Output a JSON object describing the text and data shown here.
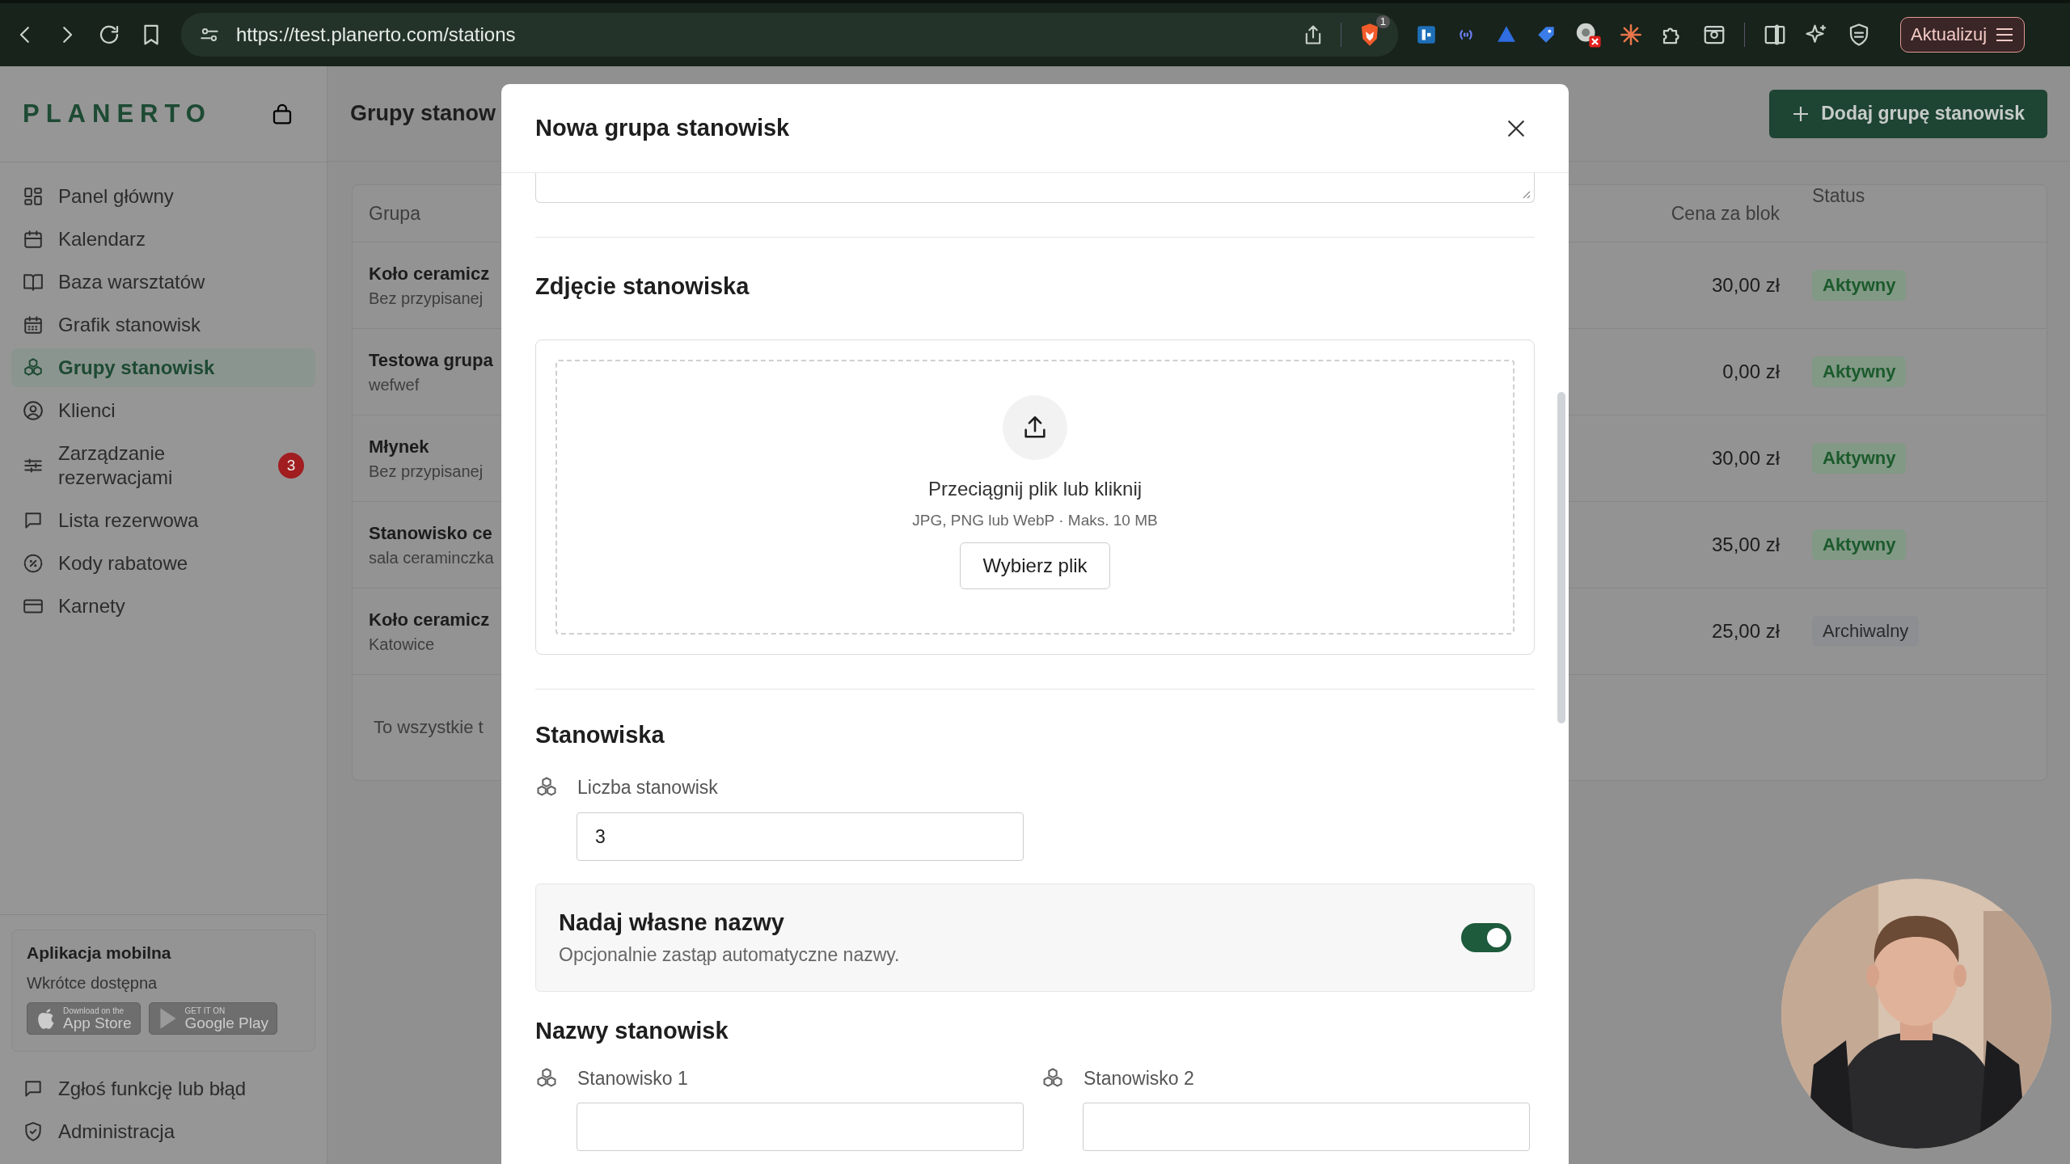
{
  "browser": {
    "url": "https://test.planerto.com/stations",
    "shield_badge": "1",
    "update_button": "Aktualizuj"
  },
  "sidebar": {
    "logo": "PLANERTO",
    "items": [
      {
        "label": "Panel główny",
        "selected": false
      },
      {
        "label": "Kalendarz",
        "selected": false
      },
      {
        "label": "Baza warsztatów",
        "selected": false
      },
      {
        "label": "Grafik stanowisk",
        "selected": false
      },
      {
        "label": "Grupy stanowisk",
        "selected": true
      },
      {
        "label": "Klienci",
        "selected": false
      },
      {
        "label": "Zarządzanie rezerwacjami",
        "selected": false,
        "badge": "3"
      },
      {
        "label": "Lista rezerwowa",
        "selected": false
      },
      {
        "label": "Kody rabatowe",
        "selected": false
      },
      {
        "label": "Karnety",
        "selected": false
      }
    ],
    "mobile_app": {
      "title": "Aplikacja mobilna",
      "subtitle": "Wkrótce dostępna",
      "stores": [
        {
          "small": "Download on the",
          "large": "App Store"
        },
        {
          "small": "GET IT ON",
          "large": "Google Play"
        }
      ]
    },
    "footer_items": [
      {
        "label": "Zgłoś funkcję lub błąd"
      },
      {
        "label": "Administracja"
      }
    ]
  },
  "page": {
    "title": "Grupy stanow",
    "add_button": "Dodaj grupę stanowisk",
    "table": {
      "columns": [
        "Grupa",
        "Cena za blok",
        "Status"
      ],
      "rows": [
        {
          "name": "Koło ceramicz",
          "subtitle": "Bez przypisanej",
          "price": "30,00 zł",
          "status": {
            "label": "Aktywny",
            "active": true
          }
        },
        {
          "name": "Testowa grupa",
          "subtitle": "wefwef",
          "price": "0,00 zł",
          "status": {
            "label": "Aktywny",
            "active": true
          }
        },
        {
          "name": "Młynek",
          "subtitle": "Bez przypisanej",
          "price": "30,00 zł",
          "status": {
            "label": "Aktywny",
            "active": true
          }
        },
        {
          "name": "Stanowisko ce",
          "subtitle": "sala ceraminczka",
          "price": "35,00 zł",
          "status": {
            "label": "Aktywny",
            "active": true
          }
        },
        {
          "name": "Koło ceramicz",
          "subtitle": "Katowice",
          "price": "25,00 zł",
          "status": {
            "label": "Archiwalny",
            "active": false
          }
        }
      ],
      "footer": "To wszystkie t"
    }
  },
  "modal": {
    "title": "Nowa grupa stanowisk",
    "photo_section": {
      "heading": "Zdjęcie stanowiska",
      "dropzone_text": "Przeciągnij plik lub kliknij",
      "hint": "JPG, PNG lub WebP · Maks. 10 MB",
      "button": "Wybierz plik"
    },
    "stations_section": {
      "heading": "Stanowiska",
      "count_label": "Liczba stanowisk",
      "count_value": "3",
      "custom_names": {
        "title": "Nadaj własne nazwy",
        "description": "Opcjonalnie zastąp automatyczne nazwy.",
        "on": true
      }
    },
    "names_section": {
      "heading": "Nazwy stanowisk",
      "fields": [
        {
          "label": "Stanowisko 1"
        },
        {
          "label": "Stanowisko 2"
        }
      ]
    }
  }
}
